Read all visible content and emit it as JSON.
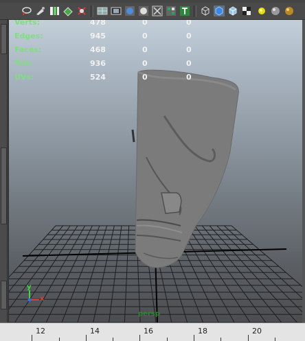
{
  "toolbar": {
    "icons": [
      "lasso-select-icon",
      "paint-select-icon",
      "uv-editor-icon",
      "snapshot-icon",
      "snap-icon",
      "wireframe-shade-icon",
      "film-gate-icon",
      "smooth-shade-icon",
      "xray-icon",
      "isolate-icon",
      "texture-icon",
      "wireframe-cube-icon",
      "shaded-cube-icon",
      "textured-cube-icon",
      "checker-icon",
      "default-light-icon",
      "all-lights-icon",
      "shadow-icon"
    ]
  },
  "hud": {
    "rows": [
      {
        "label": "Verts:",
        "v1": "478",
        "v2": "0",
        "v3": "0"
      },
      {
        "label": "Edges:",
        "v1": "945",
        "v2": "0",
        "v3": "0"
      },
      {
        "label": "Faces:",
        "v1": "468",
        "v2": "0",
        "v3": "0"
      },
      {
        "label": "Tris:",
        "v1": "936",
        "v2": "0",
        "v3": "0"
      },
      {
        "label": "UVs:",
        "v1": "524",
        "v2": "0",
        "v3": "0"
      }
    ]
  },
  "axis": {
    "y": "y",
    "x": "x",
    "y_color": "#3cdc3c",
    "x_color": "#e03a3a",
    "z_color": "#3a6be0"
  },
  "camera_label": "persp",
  "ruler": {
    "labels": [
      "12",
      "14",
      "16",
      "18",
      "20"
    ]
  },
  "colors": {
    "viewport_top": "#c3cfd9",
    "viewport_bottom": "#4c4d50",
    "hud_label": "#7fdf7f",
    "grid": "#1e1e1e",
    "mesh": "#7d7d7d"
  }
}
